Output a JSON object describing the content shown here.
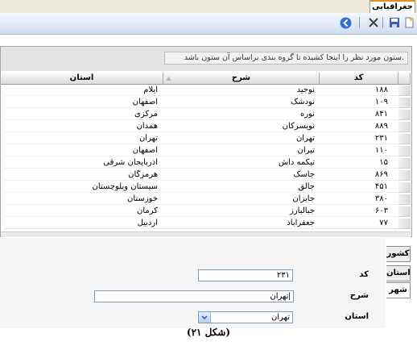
{
  "tab": {
    "title": "جغرافیایی"
  },
  "group_prompt": "ستون مورد نظر را اینجا کشیده تا گروه بندی براساس آن ستون باشد.",
  "columns": {
    "code": "کد",
    "desc": "شرح",
    "province": "استان"
  },
  "rows": [
    {
      "code": "۱۸۸",
      "desc": "نوجید",
      "province": "ایلام"
    },
    {
      "code": "۱۰۹",
      "desc": "نودشک",
      "province": "اصفهان"
    },
    {
      "code": "۸۴۱",
      "desc": "نوره",
      "province": "مرکزی"
    },
    {
      "code": "۸۸۹",
      "desc": "نویسرکان",
      "province": "همدان"
    },
    {
      "code": "۲۳۱",
      "desc": "تهران",
      "province": "تهران"
    },
    {
      "code": "۱۱۰",
      "desc": "تیران",
      "province": "اصفهان"
    },
    {
      "code": "۱۵",
      "desc": "تیکمه داش",
      "province": "آذربایجان شرقی"
    },
    {
      "code": "۸۶۹",
      "desc": "جاسک",
      "province": "هرمزگان"
    },
    {
      "code": "۴۵۱",
      "desc": "جالق",
      "province": "سیستان وبلوچستان"
    },
    {
      "code": "۳۸۰",
      "desc": "جایزان",
      "province": "خوزستان"
    },
    {
      "code": "۶۰۳",
      "desc": "جبالبارز",
      "province": "کرمان"
    },
    {
      "code": "۷۷",
      "desc": "جعفرآباد",
      "province": "اردبیل"
    }
  ],
  "side_tabs": {
    "country": "کشور",
    "province": "استان",
    "city": "شهر"
  },
  "form": {
    "code_label": "کد",
    "code_value": "۲۳۱",
    "desc_label": "شرح",
    "desc_value": "تهران|",
    "province_label": "استان",
    "province_value": "تهران"
  },
  "caption": "(شکل ۲۱)",
  "colors": {
    "accent": "#e68b2c",
    "toolbar": "#cfdcf0",
    "group_area": "#e4e4e4"
  },
  "icons": [
    "new-icon",
    "save-icon",
    "delete-icon",
    "back-icon",
    "sort-asc-icon",
    "chevron-down-icon"
  ]
}
